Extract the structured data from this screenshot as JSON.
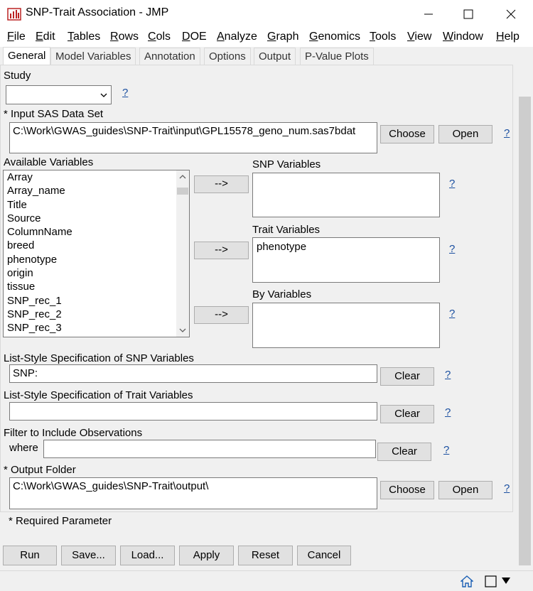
{
  "window": {
    "title": "SNP-Trait Association - JMP"
  },
  "menu": [
    "File",
    "Edit",
    "Tables",
    "Rows",
    "Cols",
    "DOE",
    "Analyze",
    "Graph",
    "Genomics",
    "Tools",
    "View",
    "Window",
    "Help"
  ],
  "tabs": [
    "General",
    "Model Variables",
    "Annotation",
    "Options",
    "Output",
    "P-Value Plots"
  ],
  "help_mark": "?",
  "study": {
    "label": "Study",
    "value": ""
  },
  "input": {
    "label": "* Input SAS Data Set",
    "value": "C:\\Work\\GWAS_guides\\SNP-Trait\\input\\GPL15578_geno_num.sas7bdat",
    "choose": "Choose",
    "open": "Open"
  },
  "available": {
    "label": "Available Variables",
    "items": [
      "Array",
      "Array_name",
      "Title",
      "Source",
      "ColumnName",
      "breed",
      "phenotype",
      "origin",
      "tissue",
      "SNP_rec_1",
      "SNP_rec_2",
      "SNP_rec_3"
    ]
  },
  "arrow_label": "-->",
  "snp_vars": {
    "label": "SNP Variables",
    "items": []
  },
  "trait_vars": {
    "label": "Trait Variables",
    "items": [
      "phenotype"
    ]
  },
  "by_vars": {
    "label": "By Variables",
    "items": []
  },
  "list_snp": {
    "label": "List-Style Specification of SNP Variables",
    "value": "SNP:",
    "clear": "Clear"
  },
  "list_trait": {
    "label": "List-Style Specification of Trait Variables",
    "value": "",
    "clear": "Clear"
  },
  "filter": {
    "label": "Filter to Include Observations",
    "where": "where",
    "value": "",
    "clear": "Clear"
  },
  "output": {
    "label": "* Output Folder",
    "value": "C:\\Work\\GWAS_guides\\SNP-Trait\\output\\",
    "choose": "Choose",
    "open": "Open"
  },
  "required_note": "* Required Parameter",
  "buttons": {
    "run": "Run",
    "save": "Save...",
    "load": "Load...",
    "apply": "Apply",
    "reset": "Reset",
    "cancel": "Cancel"
  },
  "colors": {
    "help_link": "#1a4fa0",
    "panel_bg": "#f0f0f0",
    "button_bg": "#e1e1e1"
  }
}
